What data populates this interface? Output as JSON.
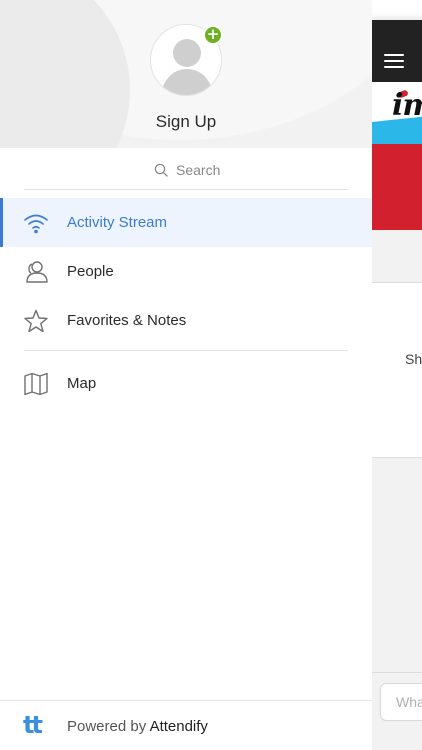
{
  "drawer": {
    "header": {
      "signup_label": "Sign Up",
      "add_badge": "+"
    },
    "search": {
      "label": "Search"
    },
    "menu": [
      {
        "label": "Activity Stream",
        "icon": "wifi-icon",
        "active": true
      },
      {
        "label": "People",
        "icon": "people-icon",
        "active": false
      },
      {
        "label": "Favorites & Notes",
        "icon": "star-icon",
        "active": false
      }
    ],
    "map": {
      "label": "Map",
      "icon": "map-icon"
    },
    "footer": {
      "logo": "tt",
      "powered_by": "Powered by ",
      "brand": "Attendify"
    }
  },
  "app_behind": {
    "banner_logo": "im",
    "card_text": "Sh",
    "input_placeholder": "Wha"
  },
  "colors": {
    "accent": "#3a7bd5",
    "active_bg": "#eef4fd",
    "plus_badge": "#6cb023",
    "banner_red": "#d2202e",
    "banner_cyan": "#2bb8e8",
    "topbar": "#222222"
  }
}
